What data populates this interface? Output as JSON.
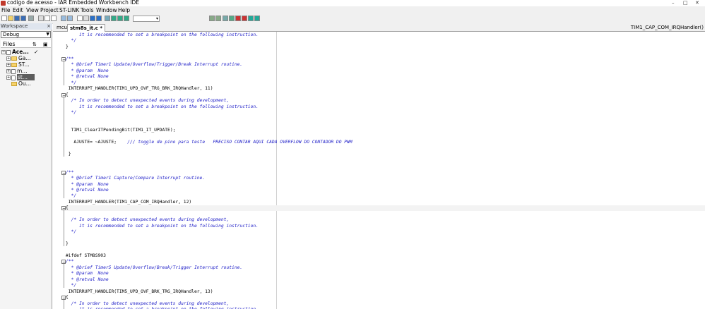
{
  "window": {
    "title": "codigo de acesso - IAR Embedded Workbench IDE",
    "controls": {
      "minimize": "–",
      "maximize": "□",
      "close": "✕"
    }
  },
  "menu": {
    "items": [
      "File",
      "Edit",
      "View",
      "Project",
      "ST-LINK",
      "Tools",
      "Window",
      "Help"
    ]
  },
  "toolbar": {
    "icons": [
      "new-file-icon",
      "open-icon",
      "save-icon",
      "save-all-icon",
      "print-icon",
      "cut-icon",
      "copy-icon",
      "paste-icon",
      "undo-icon",
      "redo-icon",
      "find-icon",
      "replace-icon",
      "find-next-icon",
      "go-to-icon",
      "bookmark-icon",
      "bookmark-next-icon",
      "bookmark-prev-icon",
      "bookmark-clear-icon",
      "navigate-back-icon",
      "navigate-forward-icon",
      "compile-icon",
      "make-icon",
      "stop-build-icon",
      "breakpoint-icon",
      "download-debug-icon",
      "debug-without-download-icon"
    ],
    "dropdown_value": ""
  },
  "workspace": {
    "title": "Workspace",
    "close_glyph": "×",
    "config": "Debug",
    "files_label": "Files",
    "tree": [
      {
        "label": "Ace...",
        "type": "project",
        "bold": true,
        "check": "✓"
      },
      {
        "label": "Ga...",
        "type": "folder"
      },
      {
        "label": "ST...",
        "type": "folder"
      },
      {
        "label": "m...",
        "type": "file"
      },
      {
        "label": "st...",
        "type": "file",
        "selected": true
      },
      {
        "label": "Ou...",
        "type": "folder"
      }
    ]
  },
  "editor": {
    "tabs": [
      {
        "label": "mcu.c",
        "active": false
      },
      {
        "label": "stm8s_it.c *",
        "active": true
      }
    ],
    "function_selector": "TIM1_CAP_COM_IRQHandler()",
    "lines": [
      {
        "t": "     it is recommended to set a breakpoint on the following instruction.",
        "k": "c"
      },
      {
        "t": "  */",
        "k": "c"
      },
      {
        "t": "}",
        "k": "n"
      },
      {
        "t": "",
        "k": "n"
      },
      {
        "t": "/**",
        "k": "c"
      },
      {
        "t": "  * @brief Timer1 Update/Overflow/Trigger/Break Interrupt routine.",
        "k": "c"
      },
      {
        "t": "  * @param  None",
        "k": "c"
      },
      {
        "t": "  * @retval None",
        "k": "c"
      },
      {
        "t": "  */",
        "k": "c"
      },
      {
        "t": " INTERRUPT_HANDLER(TIM1_UPD_OVF_TRG_BRK_IRQHandler, 11)",
        "k": "n"
      },
      {
        "t": "{",
        "k": "n"
      },
      {
        "t": "  /* In order to detect unexpected events during development,",
        "k": "c"
      },
      {
        "t": "     it is recommended to set a breakpoint on the following instruction.",
        "k": "c"
      },
      {
        "t": "  */",
        "k": "c"
      },
      {
        "t": "",
        "k": "n"
      },
      {
        "t": "",
        "k": "n"
      },
      {
        "t": "  TIM1_ClearITPendingBit(TIM1_IT_UPDATE);",
        "k": "n"
      },
      {
        "t": "",
        "k": "n"
      },
      {
        "t": "   AJUSTE= ~AJUSTE;",
        "k": "n",
        "c": "    /// toggle de pino para teste   PRECISO CONTAR AQUI CADA OVERFLOW DO CONTADOR DO PWM"
      },
      {
        "t": "",
        "k": "n"
      },
      {
        "t": " }",
        "k": "n"
      },
      {
        "t": "",
        "k": "n"
      },
      {
        "t": "",
        "k": "n"
      },
      {
        "t": "/**",
        "k": "c"
      },
      {
        "t": "  * @brief Timer1 Capture/Compare Interrupt routine.",
        "k": "c"
      },
      {
        "t": "  * @param  None",
        "k": "c"
      },
      {
        "t": "  * @retval None",
        "k": "c"
      },
      {
        "t": "  */",
        "k": "c"
      },
      {
        "t": " INTERRUPT_HANDLER(TIM1_CAP_COM_IRQHandler, 12)",
        "k": "n"
      },
      {
        "t": "{",
        "k": "n"
      },
      {
        "t": "",
        "k": "n"
      },
      {
        "t": "  /* In order to detect unexpected events during development,",
        "k": "c"
      },
      {
        "t": "     it is recommended to set a breakpoint on the following instruction.",
        "k": "c"
      },
      {
        "t": "  */",
        "k": "c"
      },
      {
        "t": "",
        "k": "n"
      },
      {
        "t": "}",
        "k": "n"
      },
      {
        "t": "",
        "k": "n"
      },
      {
        "t": "#ifdef STM8S903",
        "k": "n"
      },
      {
        "t": "/**",
        "k": "c"
      },
      {
        "t": "  * @brief Timer5 Update/Overflow/Break/Trigger Interrupt routine.",
        "k": "c"
      },
      {
        "t": "  * @param  None",
        "k": "c"
      },
      {
        "t": "  * @retval None",
        "k": "c"
      },
      {
        "t": "  */",
        "k": "c"
      },
      {
        "t": " INTERRUPT_HANDLER(TIM5_UPD_OVF_BRK_TRG_IRQHandler, 13)",
        "k": "n"
      },
      {
        "t": "{",
        "k": "n"
      },
      {
        "t": "  /* In order to detect unexpected events during development,",
        "k": "c"
      },
      {
        "t": "     it is recommended to set a breakpoint on the following instruction.",
        "k": "c"
      }
    ]
  }
}
